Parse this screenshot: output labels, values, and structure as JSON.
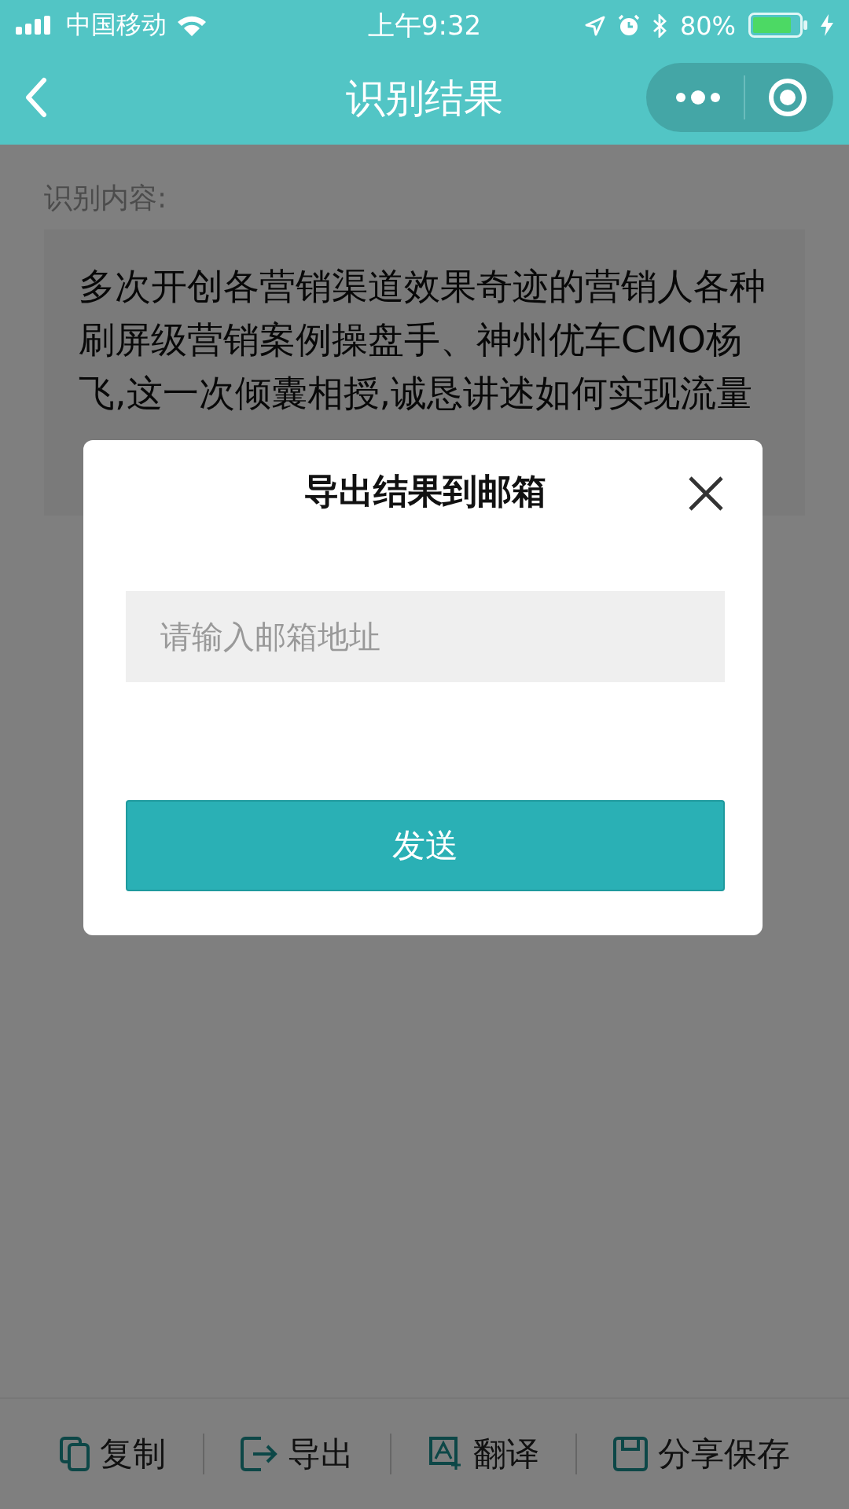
{
  "status_bar": {
    "carrier": "中国移动",
    "time": "上午9:32",
    "battery": "80%"
  },
  "nav_bar": {
    "title": "识别结果"
  },
  "content": {
    "label": "识别内容:",
    "text": "多次开创各营销渠道效果奇迹的营销人各种刷屏级营销案例操盘手、神州优车CMO杨飞,这一次倾囊相授,诚恳讲述如何实现流量"
  },
  "dialog": {
    "title": "导出结果到邮箱",
    "email_field": {
      "placeholder": "请输入邮箱地址"
    },
    "send_button": "发送"
  },
  "toolbar": [
    {
      "kind": "copy",
      "label": "复制"
    },
    {
      "kind": "export",
      "label": "导出"
    },
    {
      "kind": "translate",
      "label": "翻译"
    },
    {
      "kind": "save",
      "label": "分享保存"
    }
  ]
}
